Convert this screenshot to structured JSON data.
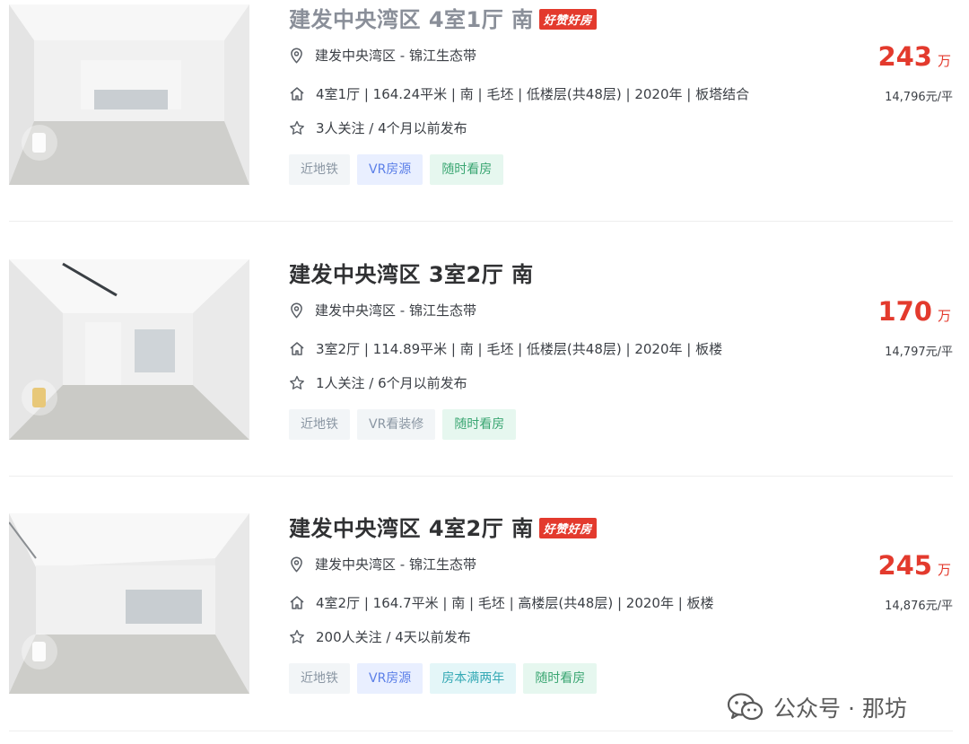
{
  "listings": [
    {
      "title": "建发中央湾区 4室1厅 南",
      "hot_badge": "好赞好房",
      "location": "建发中央湾区 - 锦江生态带",
      "info": "4室1厅 | 164.24平米 | 南 | 毛坯 | 低楼层(共48层) | 2020年 | 板塔结合",
      "follow": "3人关注 / 4个月以前发布",
      "tags": [
        "近地铁",
        "VR房源",
        "随时看房"
      ],
      "price": "243",
      "price_unit": "万",
      "unit_price": "14,796元/平"
    },
    {
      "title": "建发中央湾区 3室2厅 南",
      "location": "建发中央湾区 - 锦江生态带",
      "info": "3室2厅 | 114.89平米 | 南 | 毛坯 | 低楼层(共48层) | 2020年 | 板楼",
      "follow": "1人关注 / 6个月以前发布",
      "tags": [
        "近地铁",
        "VR看装修",
        "随时看房"
      ],
      "price": "170",
      "price_unit": "万",
      "unit_price": "14,797元/平"
    },
    {
      "title": "建发中央湾区 4室2厅 南",
      "hot_badge": "好赞好房",
      "location": "建发中央湾区 - 锦江生态带",
      "info": "4室2厅 | 164.7平米 | 南 | 毛坯 | 高楼层(共48层) | 2020年 | 板楼",
      "follow": "200人关注 / 4天以前发布",
      "tags": [
        "近地铁",
        "VR房源",
        "房本满两年",
        "随时看房"
      ],
      "price": "245",
      "price_unit": "万",
      "unit_price": "14,876元/平"
    }
  ],
  "watermark": "公众号 · 那坊",
  "colors": {
    "price_red": "#e33a2d",
    "badge_red": "#e33a2d"
  },
  "icons": [
    "location-pin-icon",
    "house-icon",
    "star-icon",
    "wechat-icon",
    "vr-icon"
  ]
}
